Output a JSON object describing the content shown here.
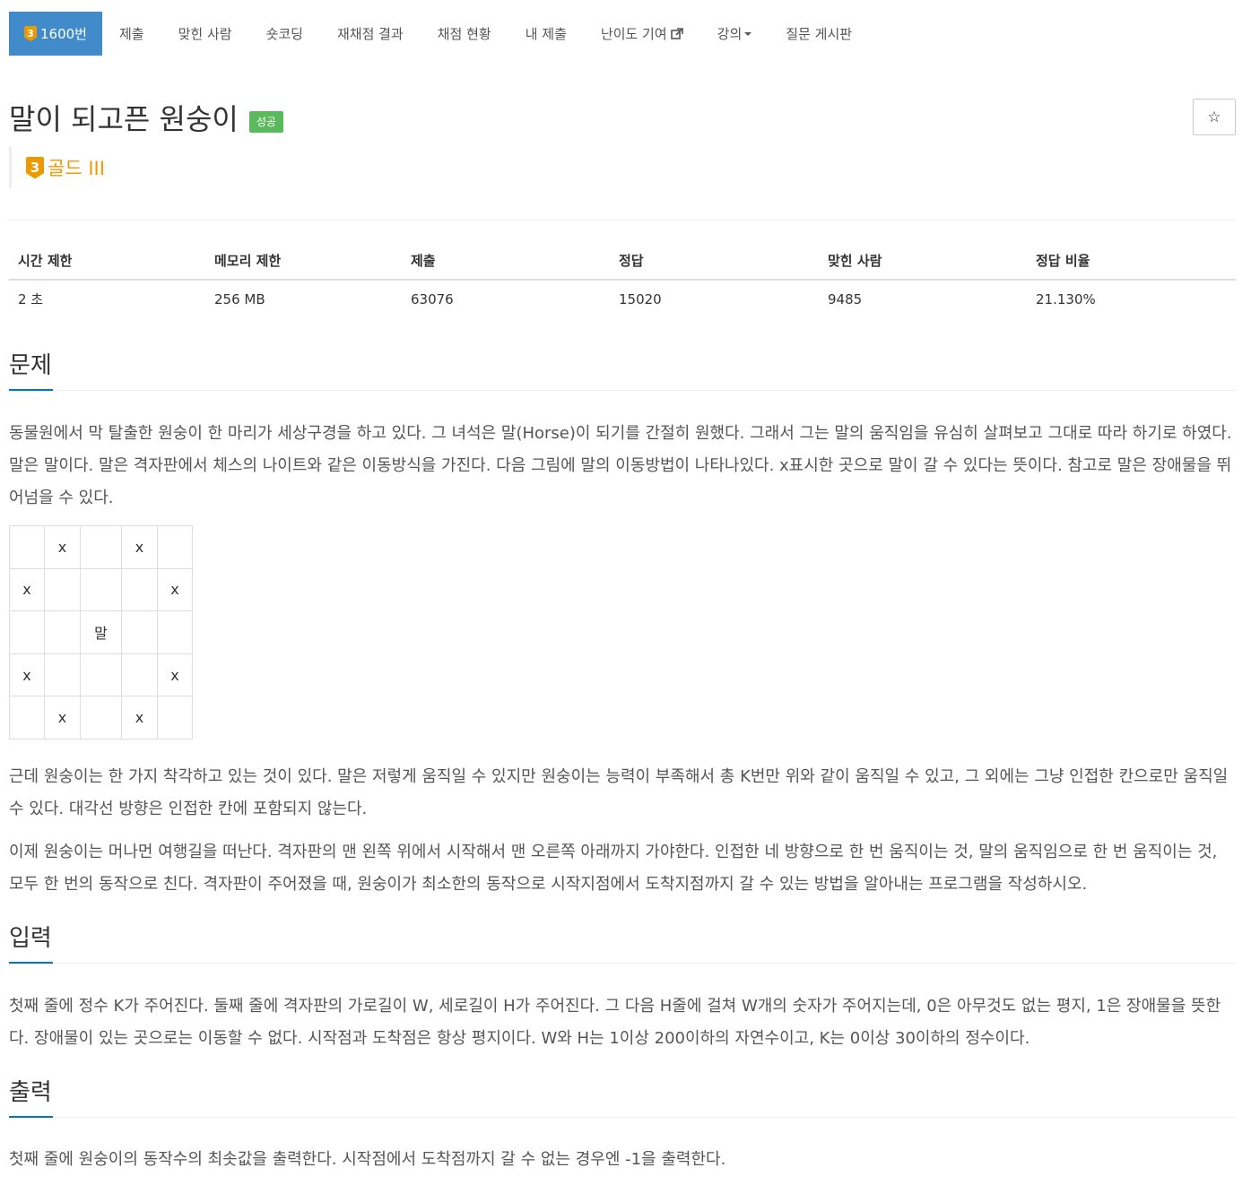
{
  "nav": {
    "problem_number": "1600번",
    "tier_badge": "3",
    "items": [
      "제출",
      "맞힌 사람",
      "숏코딩",
      "재채점 결과",
      "채점 현황",
      "내 제출",
      "난이도 기여",
      "강의",
      "질문 게시판"
    ]
  },
  "problem": {
    "title": "말이 되고픈 원숭이",
    "status_label": "성공",
    "star": "☆",
    "tier_number": "3",
    "tier_name": "골드 III"
  },
  "stats": {
    "headers": [
      "시간 제한",
      "메모리 제한",
      "제출",
      "정답",
      "맞힌 사람",
      "정답 비율"
    ],
    "values": [
      "2 초",
      "256 MB",
      "63076",
      "15020",
      "9485",
      "21.130%"
    ]
  },
  "sections": {
    "problem_heading": "문제",
    "problem_p1": "동물원에서 막 탈출한 원숭이 한 마리가 세상구경을 하고 있다. 그 녀석은 말(Horse)이 되기를 간절히 원했다. 그래서 그는 말의 움직임을 유심히 살펴보고 그대로 따라 하기로 하였다. 말은 말이다. 말은 격자판에서 체스의 나이트와 같은 이동방식을 가진다. 다음 그림에 말의 이동방법이 나타나있다. x표시한 곳으로 말이 갈 수 있다는 뜻이다. 참고로 말은 장애물을 뛰어넘을 수 있다.",
    "problem_p2": "근데 원숭이는 한 가지 착각하고 있는 것이 있다. 말은 저렇게 움직일 수 있지만 원숭이는 능력이 부족해서 총 K번만 위와 같이 움직일 수 있고, 그 외에는 그냥 인접한 칸으로만 움직일 수 있다. 대각선 방향은 인접한 칸에 포함되지 않는다.",
    "problem_p3": "이제 원숭이는 머나먼 여행길을 떠난다. 격자판의 맨 왼쪽 위에서 시작해서 맨 오른쪽 아래까지 가야한다. 인접한 네 방향으로 한 번 움직이는 것, 말의 움직임으로 한 번 움직이는 것, 모두 한 번의 동작으로 친다. 격자판이 주어졌을 때, 원숭이가 최소한의 동작으로 시작지점에서 도착지점까지 갈 수 있는 방법을 알아내는 프로그램을 작성하시오.",
    "input_heading": "입력",
    "input_p": "첫째 줄에 정수 K가 주어진다. 둘째 줄에 격자판의 가로길이 W, 세로길이 H가 주어진다. 그 다음 H줄에 걸쳐 W개의 숫자가 주어지는데, 0은 아무것도 없는 평지, 1은 장애물을 뜻한다. 장애물이 있는 곳으로는 이동할 수 없다. 시작점과 도착점은 항상 평지이다. W와 H는 1이상 200이하의 자연수이고, K는 0이상 30이하의 정수이다.",
    "output_heading": "출력",
    "output_p": "첫째 줄에 원숭이의 동작수의 최솟값을 출력한다. 시작점에서 도착점까지 갈 수 없는 경우엔 -1을 출력한다."
  },
  "board": [
    [
      "",
      "x",
      "",
      "x",
      ""
    ],
    [
      "x",
      "",
      "",
      "",
      "x"
    ],
    [
      "",
      "",
      "말",
      "",
      ""
    ],
    [
      "x",
      "",
      "",
      "",
      "x"
    ],
    [
      "",
      "x",
      "",
      "x",
      ""
    ]
  ]
}
